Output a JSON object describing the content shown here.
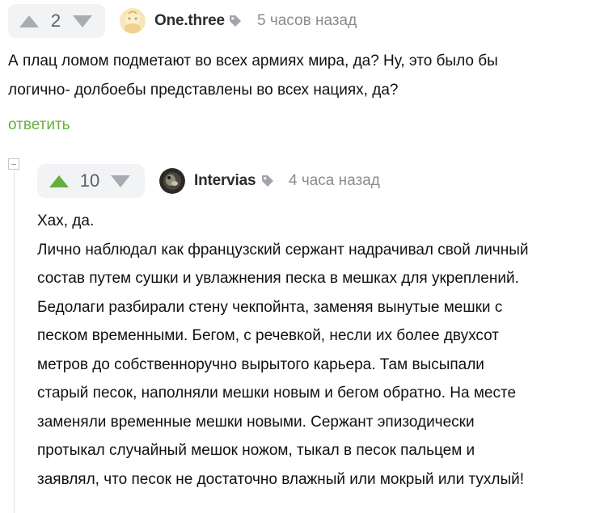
{
  "comments": [
    {
      "rating": "2",
      "author": "One.three",
      "time": "5 часов назад",
      "text_lines": [
        "А плац ломом подметают во всех армиях мира, да? Ну, это было бы",
        "логично- долбоебы представлены во всех нациях, да?"
      ],
      "reply_label": "ответить",
      "avatar_icon": "avatar-cream-icon",
      "upvoted": false
    },
    {
      "rating": "10",
      "author": "Intervias",
      "time": "4 часа назад",
      "text_lines": [
        "Хах, да.",
        "Лично наблюдал как французский сержант надрачивал свой личный",
        "состав путем сушки и увлажнения песка в мешках для укреплений.",
        "Бедолаги разбирали стену чекпойнта, заменяя вынутые мешки с",
        "песком временными. Бегом, с речевкой, несли их более двухсот",
        "метров до собственноручно вырытого карьера. Там высыпали",
        "старый песок, наполняли мешки новым и бегом обратно. На месте",
        "заменяли временные мешки новыми. Сержант эпизодически",
        "протыкал случайный мешок ножом, тыкал в песок пальцем и",
        "заявлял, что песок не достаточно влажный или мокрый или тухлый!"
      ],
      "avatar_icon": "avatar-dark-icon",
      "upvoted": true
    }
  ],
  "colors": {
    "accent_green": "#65b03d",
    "pill_bg": "#f2f3f5",
    "arrow_gray": "#a9abb2"
  }
}
